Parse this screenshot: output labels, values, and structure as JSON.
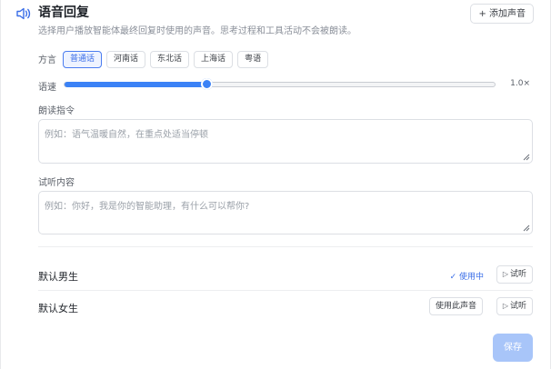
{
  "header": {
    "title": "语音回复",
    "add_voice_label": "+ 添加声音"
  },
  "description": "选择用户播放智能体最终回复时使用的声音。思考过程和工具活动不会被朗读。",
  "dialect": {
    "label": "方言",
    "options": [
      "普通话",
      "河南话",
      "东北话",
      "上海话",
      "粤语"
    ],
    "selected": "普通话"
  },
  "speed": {
    "label": "语速",
    "value_text": "1.0×",
    "position_fraction": 0.33
  },
  "instruction": {
    "label": "朗读指令",
    "placeholder": "例如：语气温暖自然，在重点处适当停顿"
  },
  "preview": {
    "label": "试听内容",
    "placeholder": "例如：你好，我是你的智能助理，有什么可以帮你?"
  },
  "voices": [
    {
      "name": "默认男生",
      "status": "✓ 使用中",
      "listen": "试听"
    },
    {
      "name": "默认女生",
      "use_label": "使用此声音",
      "listen": "试听"
    }
  ],
  "save_label": "保存",
  "colors": {
    "accent": "#3b82f6",
    "save_disabled": "#a8c5f9"
  }
}
